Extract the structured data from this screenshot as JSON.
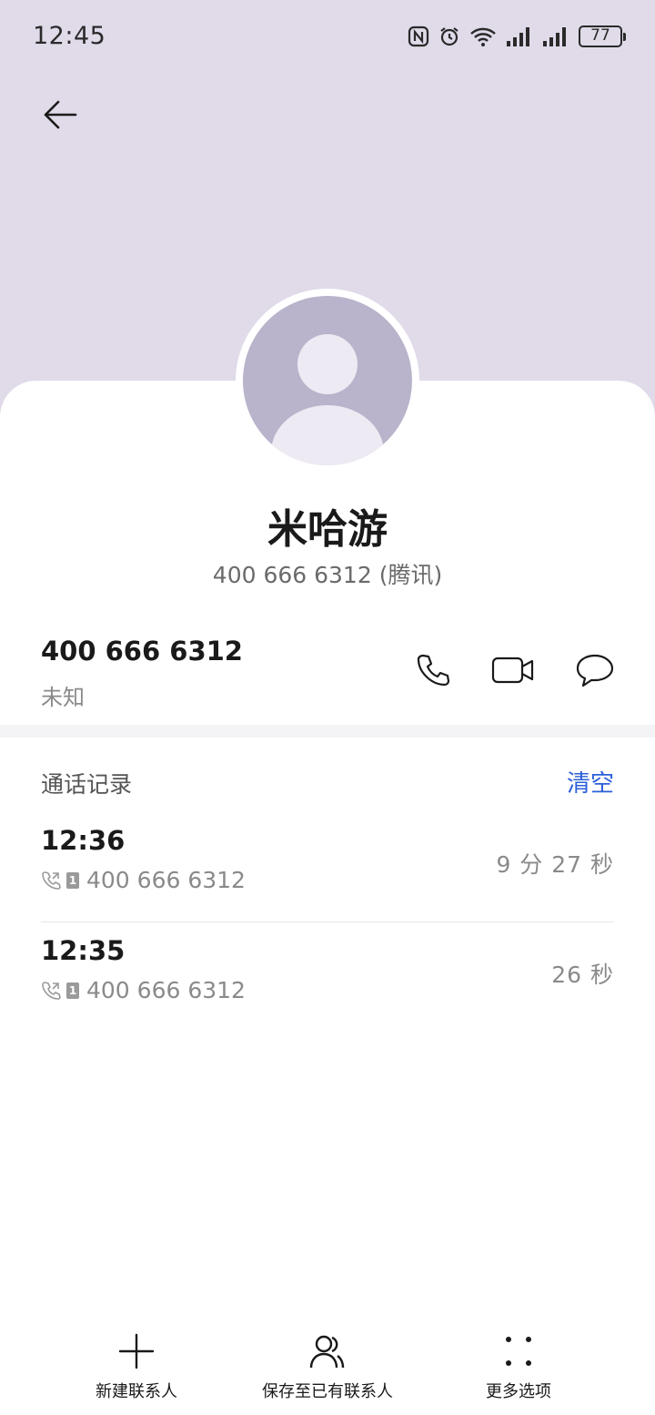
{
  "status_bar": {
    "time": "12:45",
    "battery": "77",
    "icons": [
      "nfc-icon",
      "alarm-icon",
      "wifi-icon",
      "signal-icon",
      "signal-icon",
      "battery-icon"
    ]
  },
  "header": {
    "back_icon": "back-arrow-icon"
  },
  "contact": {
    "name": "米哈游",
    "subtitle": "400 666 6312 (腾讯)",
    "avatar_icon": "default-avatar-icon"
  },
  "number": {
    "value": "400 666 6312",
    "type": "未知",
    "actions": [
      "phone-icon",
      "video-call-icon",
      "message-icon"
    ]
  },
  "call_log": {
    "title": "通话记录",
    "clear_label": "清空",
    "entries": [
      {
        "time": "12:36",
        "number": "400 666 6312",
        "duration": "9 分 27 秒",
        "sim": "1"
      },
      {
        "time": "12:35",
        "number": "400 666 6312",
        "duration": "26 秒",
        "sim": "1"
      }
    ]
  },
  "bottom_bar": {
    "items": [
      {
        "label": "新建联系人",
        "icon": "plus-icon"
      },
      {
        "label": "保存至已有联系人",
        "icon": "contacts-icon"
      },
      {
        "label": "更多选项",
        "icon": "more-dots-icon"
      }
    ]
  },
  "colors": {
    "header_bg": "#e0dae9",
    "avatar_bg": "#b9b3cb",
    "accent": "#2b5fd9"
  }
}
